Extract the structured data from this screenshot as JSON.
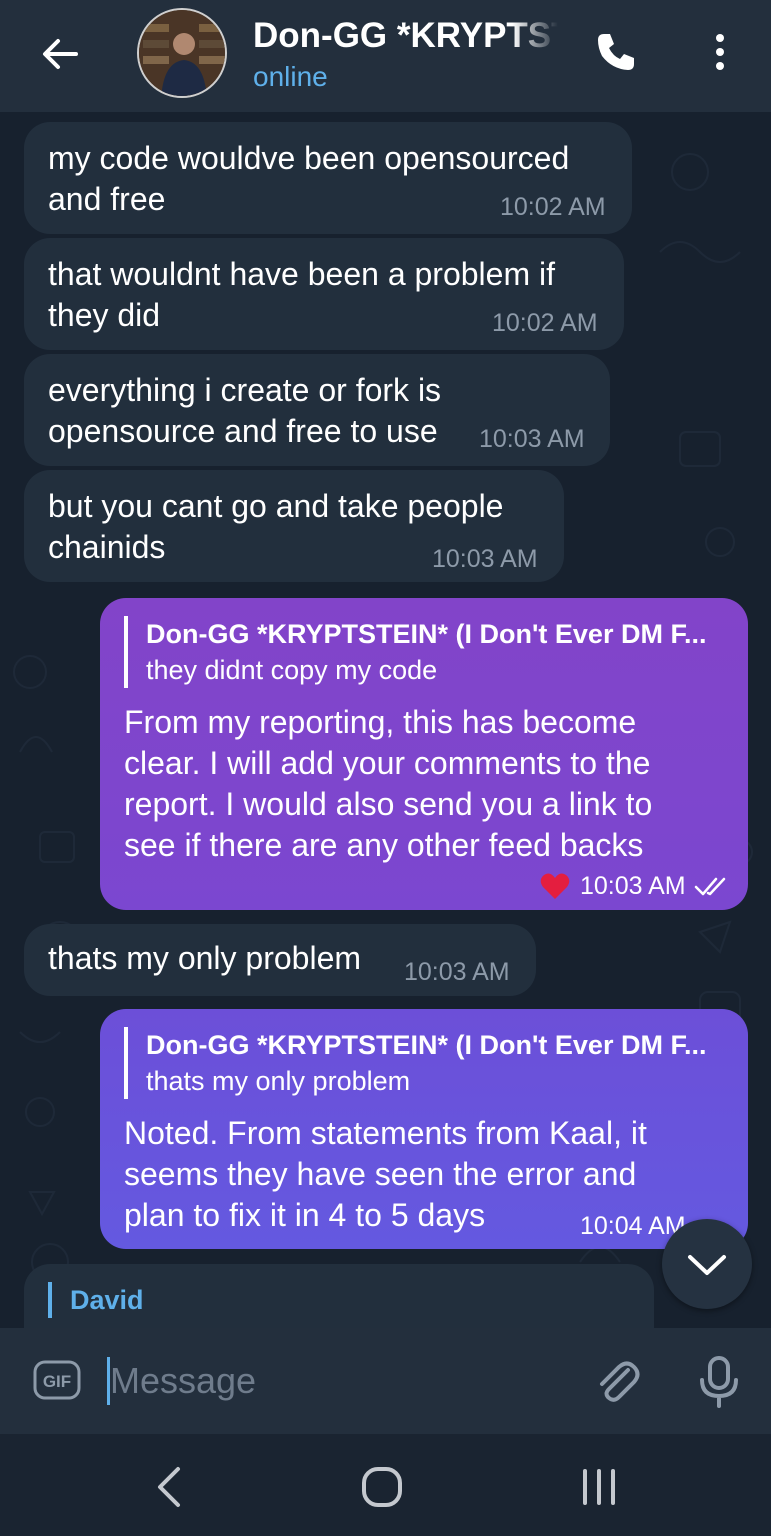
{
  "header": {
    "title": "Don-GG *KRYPTSTEIN* (I Don't Ever DM F...",
    "status": "online"
  },
  "messages": [
    {
      "text_l1": "my code wouldve been opensourced",
      "text_l2": "and free",
      "time": "10:02 AM"
    },
    {
      "text_l1": "that wouldnt have been a problem if",
      "text_l2": "they did",
      "time": "10:02 AM"
    },
    {
      "text_l1": "everything i create or fork is",
      "text_l2": "opensource and free to use",
      "time": "10:03 AM"
    },
    {
      "text_l1": "but you cant go and take people",
      "text_l2": "chainids",
      "time": "10:03 AM"
    },
    {
      "reply_name": "Don-GG *KRYPTSTEIN* (I Don't Ever DM F...",
      "reply_text": "they didnt copy my code",
      "lines": [
        "From my reporting, this has become",
        "clear. I will add your comments to the",
        "report. I would also send you a link to",
        "see if there are any other feed backs"
      ],
      "time": "10:03 AM",
      "reaction": "❤️"
    },
    {
      "text_l1": "thats my only problem",
      "time": "10:03 AM"
    },
    {
      "reply_name": "Don-GG *KRYPTSTEIN* (I Don't Ever DM F...",
      "reply_text": "thats my only problem",
      "lines": [
        "Noted. From statements from Kaal, it",
        "seems they have seen the error and",
        "plan to fix it in 4 to 5 days"
      ],
      "time": "10:04 AM"
    },
    {
      "reply_name": "David"
    }
  ],
  "input": {
    "placeholder": "Message",
    "gif_label": "GIF"
  },
  "colors": {
    "accent": "#5fb0ea",
    "outgoing_top": "#8244c9",
    "outgoing_bottom": "#6459e0",
    "incoming": "#222f3d"
  }
}
